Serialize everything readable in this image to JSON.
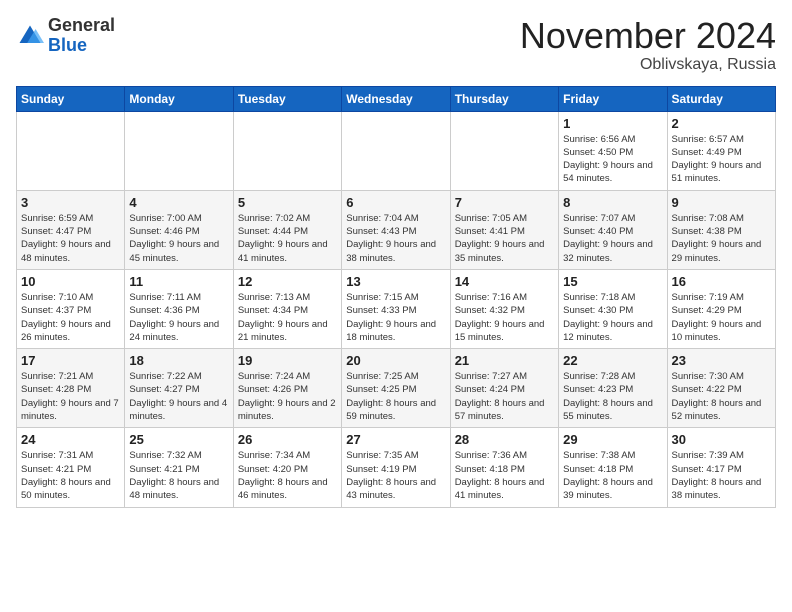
{
  "logo": {
    "general": "General",
    "blue": "Blue"
  },
  "title": {
    "month": "November 2024",
    "location": "Oblivskaya, Russia"
  },
  "days_header": [
    "Sunday",
    "Monday",
    "Tuesday",
    "Wednesday",
    "Thursday",
    "Friday",
    "Saturday"
  ],
  "weeks": [
    [
      {
        "day": "",
        "info": ""
      },
      {
        "day": "",
        "info": ""
      },
      {
        "day": "",
        "info": ""
      },
      {
        "day": "",
        "info": ""
      },
      {
        "day": "",
        "info": ""
      },
      {
        "day": "1",
        "info": "Sunrise: 6:56 AM\nSunset: 4:50 PM\nDaylight: 9 hours and 54 minutes."
      },
      {
        "day": "2",
        "info": "Sunrise: 6:57 AM\nSunset: 4:49 PM\nDaylight: 9 hours and 51 minutes."
      }
    ],
    [
      {
        "day": "3",
        "info": "Sunrise: 6:59 AM\nSunset: 4:47 PM\nDaylight: 9 hours and 48 minutes."
      },
      {
        "day": "4",
        "info": "Sunrise: 7:00 AM\nSunset: 4:46 PM\nDaylight: 9 hours and 45 minutes."
      },
      {
        "day": "5",
        "info": "Sunrise: 7:02 AM\nSunset: 4:44 PM\nDaylight: 9 hours and 41 minutes."
      },
      {
        "day": "6",
        "info": "Sunrise: 7:04 AM\nSunset: 4:43 PM\nDaylight: 9 hours and 38 minutes."
      },
      {
        "day": "7",
        "info": "Sunrise: 7:05 AM\nSunset: 4:41 PM\nDaylight: 9 hours and 35 minutes."
      },
      {
        "day": "8",
        "info": "Sunrise: 7:07 AM\nSunset: 4:40 PM\nDaylight: 9 hours and 32 minutes."
      },
      {
        "day": "9",
        "info": "Sunrise: 7:08 AM\nSunset: 4:38 PM\nDaylight: 9 hours and 29 minutes."
      }
    ],
    [
      {
        "day": "10",
        "info": "Sunrise: 7:10 AM\nSunset: 4:37 PM\nDaylight: 9 hours and 26 minutes."
      },
      {
        "day": "11",
        "info": "Sunrise: 7:11 AM\nSunset: 4:36 PM\nDaylight: 9 hours and 24 minutes."
      },
      {
        "day": "12",
        "info": "Sunrise: 7:13 AM\nSunset: 4:34 PM\nDaylight: 9 hours and 21 minutes."
      },
      {
        "day": "13",
        "info": "Sunrise: 7:15 AM\nSunset: 4:33 PM\nDaylight: 9 hours and 18 minutes."
      },
      {
        "day": "14",
        "info": "Sunrise: 7:16 AM\nSunset: 4:32 PM\nDaylight: 9 hours and 15 minutes."
      },
      {
        "day": "15",
        "info": "Sunrise: 7:18 AM\nSunset: 4:30 PM\nDaylight: 9 hours and 12 minutes."
      },
      {
        "day": "16",
        "info": "Sunrise: 7:19 AM\nSunset: 4:29 PM\nDaylight: 9 hours and 10 minutes."
      }
    ],
    [
      {
        "day": "17",
        "info": "Sunrise: 7:21 AM\nSunset: 4:28 PM\nDaylight: 9 hours and 7 minutes."
      },
      {
        "day": "18",
        "info": "Sunrise: 7:22 AM\nSunset: 4:27 PM\nDaylight: 9 hours and 4 minutes."
      },
      {
        "day": "19",
        "info": "Sunrise: 7:24 AM\nSunset: 4:26 PM\nDaylight: 9 hours and 2 minutes."
      },
      {
        "day": "20",
        "info": "Sunrise: 7:25 AM\nSunset: 4:25 PM\nDaylight: 8 hours and 59 minutes."
      },
      {
        "day": "21",
        "info": "Sunrise: 7:27 AM\nSunset: 4:24 PM\nDaylight: 8 hours and 57 minutes."
      },
      {
        "day": "22",
        "info": "Sunrise: 7:28 AM\nSunset: 4:23 PM\nDaylight: 8 hours and 55 minutes."
      },
      {
        "day": "23",
        "info": "Sunrise: 7:30 AM\nSunset: 4:22 PM\nDaylight: 8 hours and 52 minutes."
      }
    ],
    [
      {
        "day": "24",
        "info": "Sunrise: 7:31 AM\nSunset: 4:21 PM\nDaylight: 8 hours and 50 minutes."
      },
      {
        "day": "25",
        "info": "Sunrise: 7:32 AM\nSunset: 4:21 PM\nDaylight: 8 hours and 48 minutes."
      },
      {
        "day": "26",
        "info": "Sunrise: 7:34 AM\nSunset: 4:20 PM\nDaylight: 8 hours and 46 minutes."
      },
      {
        "day": "27",
        "info": "Sunrise: 7:35 AM\nSunset: 4:19 PM\nDaylight: 8 hours and 43 minutes."
      },
      {
        "day": "28",
        "info": "Sunrise: 7:36 AM\nSunset: 4:18 PM\nDaylight: 8 hours and 41 minutes."
      },
      {
        "day": "29",
        "info": "Sunrise: 7:38 AM\nSunset: 4:18 PM\nDaylight: 8 hours and 39 minutes."
      },
      {
        "day": "30",
        "info": "Sunrise: 7:39 AM\nSunset: 4:17 PM\nDaylight: 8 hours and 38 minutes."
      }
    ]
  ]
}
